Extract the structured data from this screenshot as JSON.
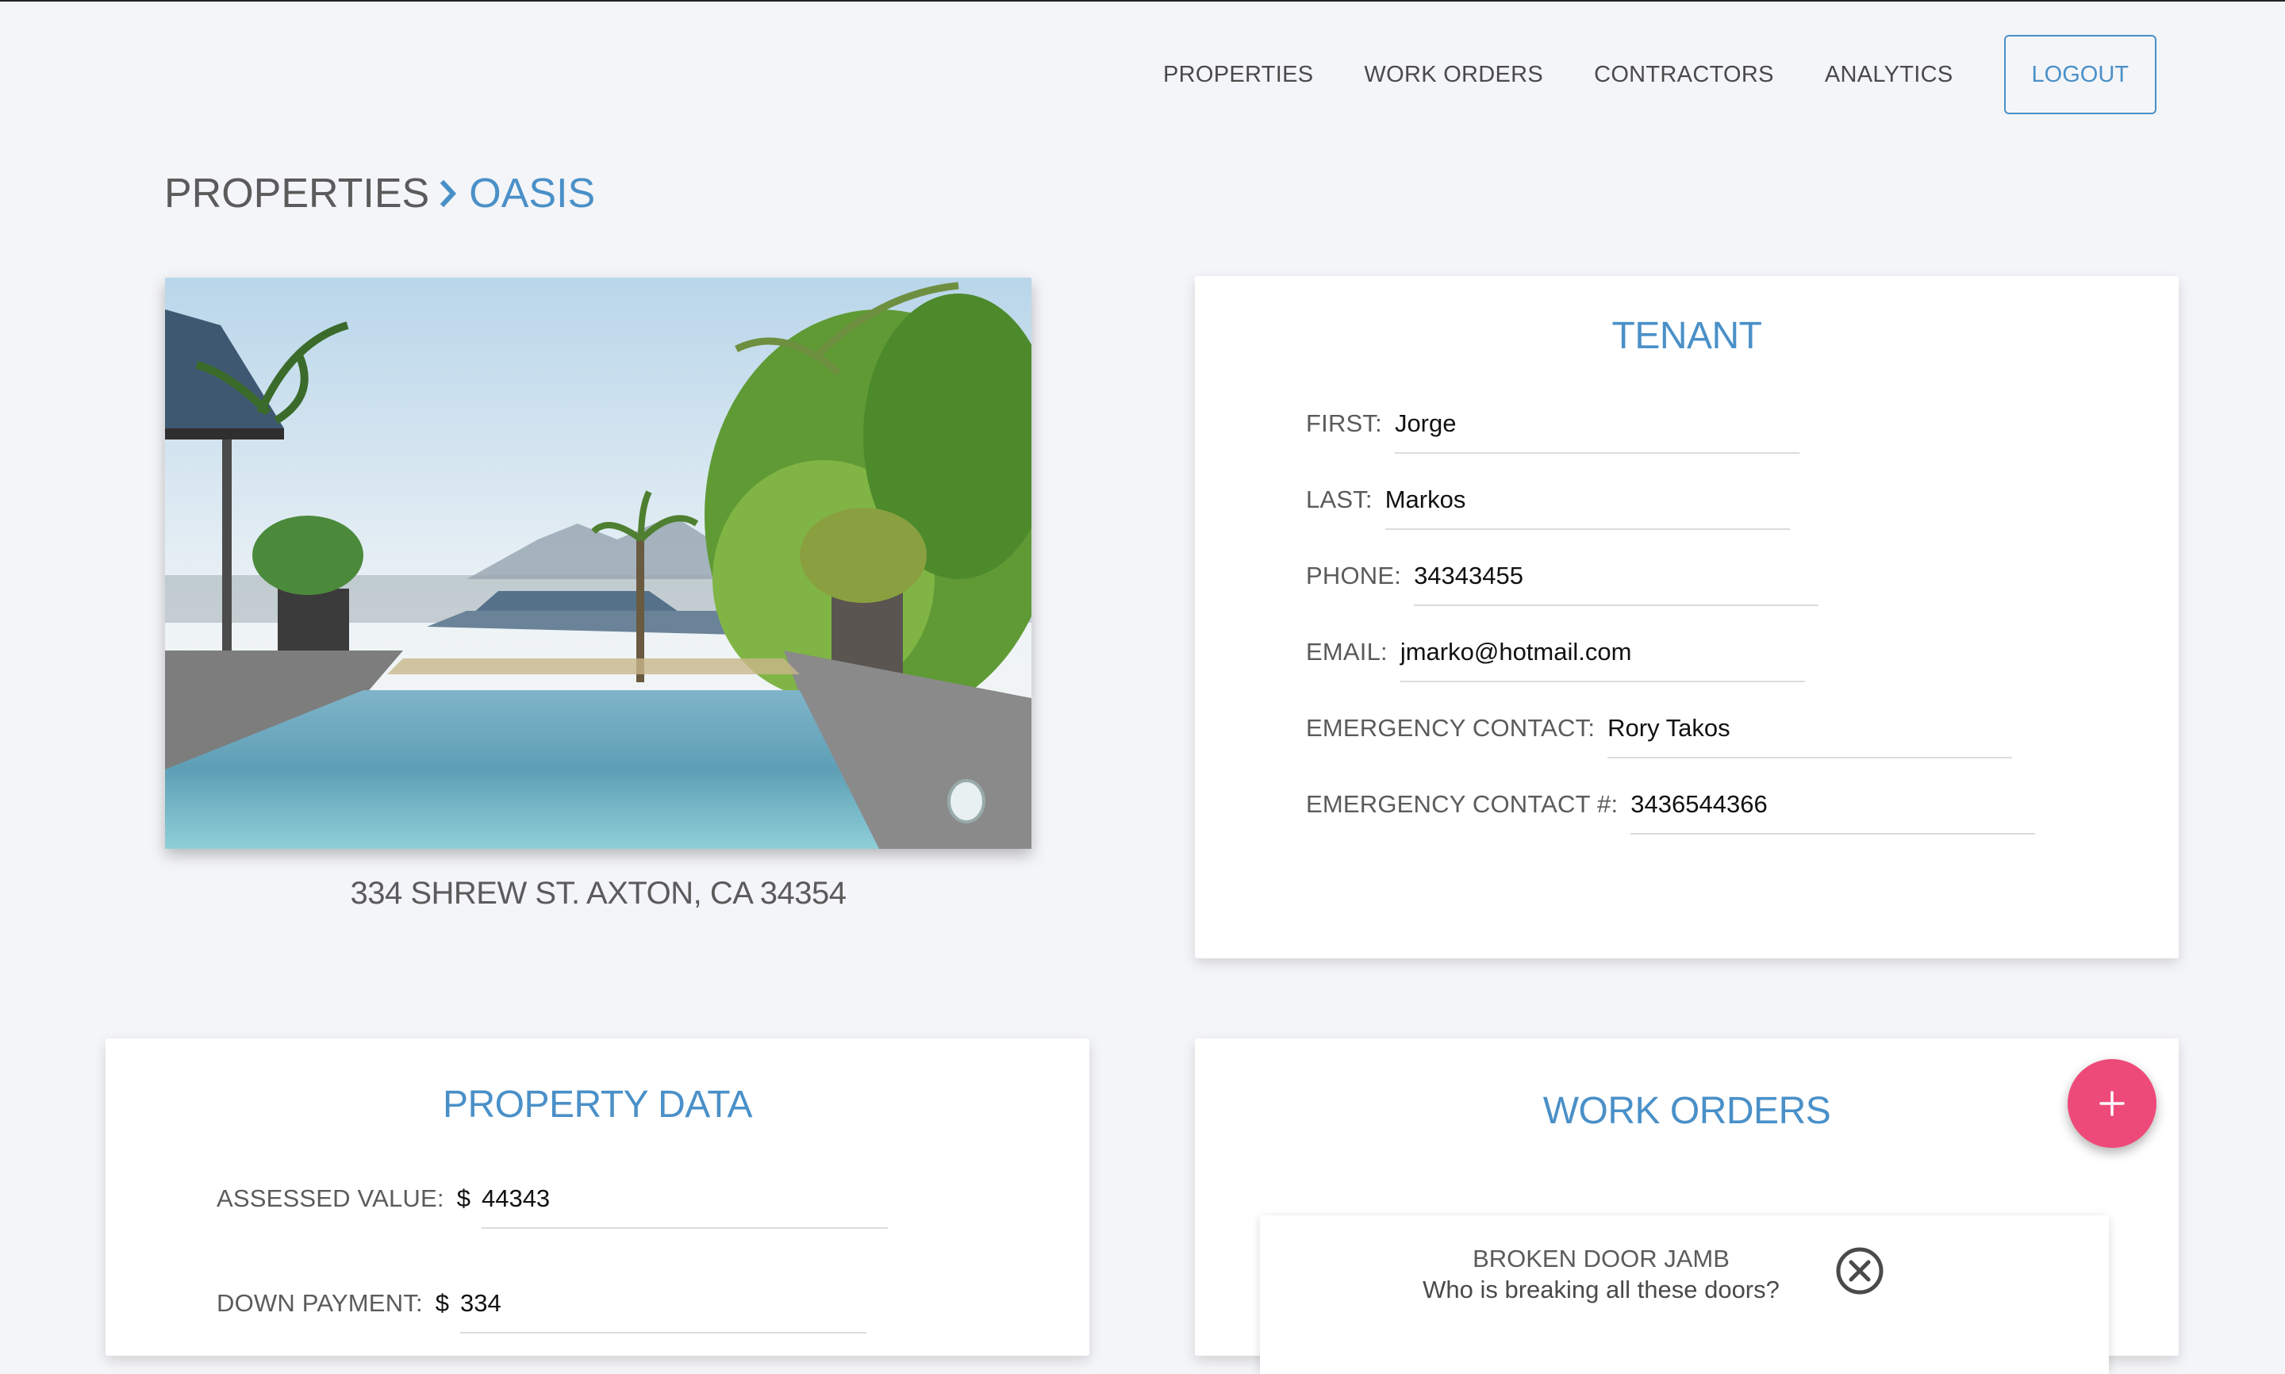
{
  "nav": {
    "items": [
      "PROPERTIES",
      "WORK ORDERS",
      "CONTRACTORS",
      "ANALYTICS"
    ],
    "logout_label": "LOGOUT"
  },
  "breadcrumb": {
    "root": "PROPERTIES",
    "current": "OASIS"
  },
  "property": {
    "address": "334 SHREW ST. AXTON, CA 34354"
  },
  "tenant": {
    "title": "TENANT",
    "fields": [
      {
        "label": "FIRST:",
        "value": "Jorge"
      },
      {
        "label": "LAST:",
        "value": "Markos"
      },
      {
        "label": "PHONE:",
        "value": "34343455"
      },
      {
        "label": "EMAIL:",
        "value": "jmarko@hotmail.com"
      },
      {
        "label": "EMERGENCY CONTACT:",
        "value": "Rory Takos"
      },
      {
        "label": "EMERGENCY CONTACT #:",
        "value": "3436544366"
      }
    ]
  },
  "property_data": {
    "title": "PROPERTY DATA",
    "currency_symbol": "$",
    "fields": [
      {
        "label": "ASSESSED VALUE:",
        "value": "44343"
      },
      {
        "label": "DOWN PAYMENT:",
        "value": "334"
      }
    ]
  },
  "work_orders": {
    "title": "WORK ORDERS",
    "add_icon": "plus-icon",
    "items": [
      {
        "title": "BROKEN DOOR JAMB",
        "description": "Who is breaking all these doors?"
      }
    ]
  },
  "colors": {
    "accent": "#4a90c8",
    "fab": "#ee4a79",
    "background": "#f4f5f8"
  }
}
